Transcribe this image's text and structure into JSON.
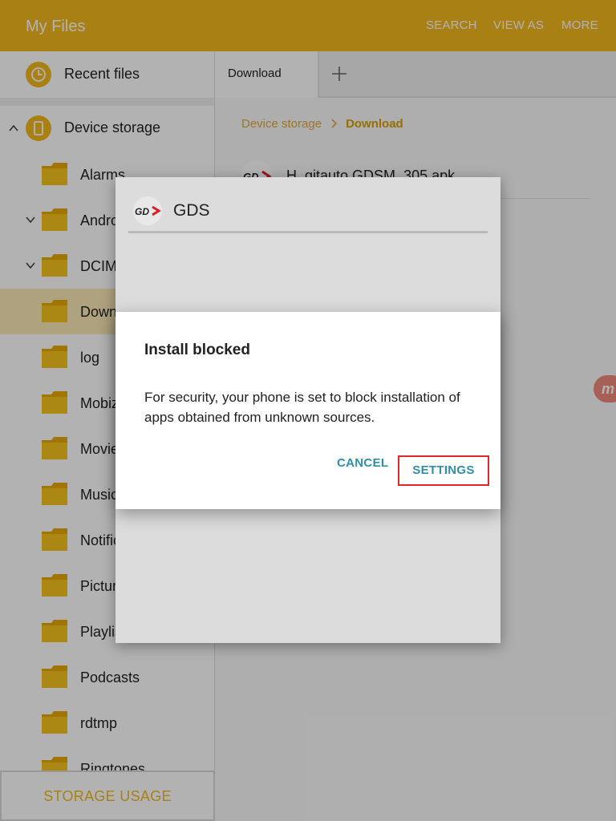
{
  "appbar": {
    "title": "My Files",
    "actions": {
      "search": "SEARCH",
      "view_as": "VIEW AS",
      "more": "MORE"
    }
  },
  "sidebar": {
    "recent_files": "Recent files",
    "device_storage": "Device storage",
    "folders": [
      {
        "label": "Alarms"
      },
      {
        "label": "Android"
      },
      {
        "label": "DCIM"
      },
      {
        "label": "Download"
      },
      {
        "label": "log"
      },
      {
        "label": "Mobizen"
      },
      {
        "label": "Movies"
      },
      {
        "label": "Music"
      },
      {
        "label": "Notifications"
      },
      {
        "label": "Pictures"
      },
      {
        "label": "Playlists"
      },
      {
        "label": "Podcasts"
      },
      {
        "label": "rdtmp"
      },
      {
        "label": "Ringtones"
      }
    ],
    "storage_usage": "STORAGE USAGE"
  },
  "tabs": {
    "download": "Download"
  },
  "breadcrumb": {
    "root": "Device storage",
    "current": "Download"
  },
  "file": {
    "name": "H_gitauto GDSM_305.apk"
  },
  "badge": "m",
  "installer": {
    "app_name": "GDS",
    "logo_text": "GDS"
  },
  "dialog": {
    "title": "Install blocked",
    "body": "For security, your phone is set to block installation of apps obtained from unknown sources.",
    "cancel": "CANCEL",
    "settings": "SETTINGS"
  },
  "colors": {
    "accent": "#f2b81e",
    "link": "#2f8fa8",
    "highlight_box": "#e0262e"
  }
}
